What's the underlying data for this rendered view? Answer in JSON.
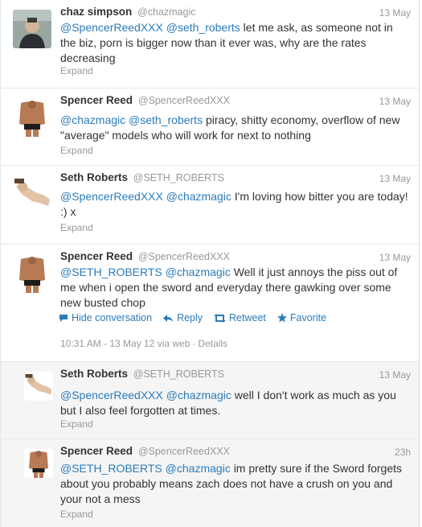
{
  "tweets": [
    {
      "fullname": "chaz simpson",
      "username": "@chazmagic",
      "time": "13 May",
      "mentions": [
        "@SpencerReedXXX",
        "@seth_roberts"
      ],
      "text": "let me ask, as someone not in the biz, porn is bigger now than it ever was, why are the rates decreasing",
      "expand": "Expand"
    },
    {
      "fullname": "Spencer Reed",
      "username": "@SpencerReedXXX",
      "time": "13 May",
      "mentions": [
        "@chazmagic",
        "@seth_roberts"
      ],
      "text": "piracy, shitty economy, overflow of new \"average\" models who will work for next to nothing",
      "expand": "Expand"
    },
    {
      "fullname": "Seth Roberts",
      "username": "@SETH_ROBERTS",
      "time": "13 May",
      "mentions": [
        "@SpencerReedXXX",
        "@chazmagic"
      ],
      "text": "I'm loving how bitter you are today! :) x",
      "expand": "Expand"
    },
    {
      "fullname": "Spencer Reed",
      "username": "@SpencerReedXXX",
      "time": "13 May",
      "mentions": [
        "@SETH_ROBERTS",
        "@chazmagic"
      ],
      "text": "Well it just annoys the piss out of me when i open the sword and everyday there gawking over some new busted chop",
      "actions": {
        "hide": "Hide conversation",
        "reply": "Reply",
        "retweet": "Retweet",
        "favorite": "Favorite"
      },
      "details": {
        "timestamp": "10:31 AM - 13 May 12 via web",
        "link": "Details"
      }
    },
    {
      "fullname": "Seth Roberts",
      "username": "@SETH_ROBERTS",
      "time": "13 May",
      "mentions": [
        "@SpencerReedXXX",
        "@chazmagic"
      ],
      "text": "well I don't work as much as you but I also feel forgotten at times.",
      "expand": "Expand"
    },
    {
      "fullname": "Spencer Reed",
      "username": "@SpencerReedXXX",
      "time": "23h",
      "mentions": [
        "@SETH_ROBERTS",
        "@chazmagic"
      ],
      "text": "im pretty sure if the Sword forgets about you probably means zach does not have a crush on you and your not a mess",
      "expand": "Expand"
    }
  ],
  "colors": {
    "link": "#2b7bb9",
    "muted": "#999999",
    "text": "#333333",
    "reply_bg": "#f5f5f5"
  },
  "icons": {
    "hide": "conversation-bubble-icon",
    "reply": "reply-arrow-icon",
    "retweet": "retweet-icon",
    "favorite": "star-icon"
  }
}
